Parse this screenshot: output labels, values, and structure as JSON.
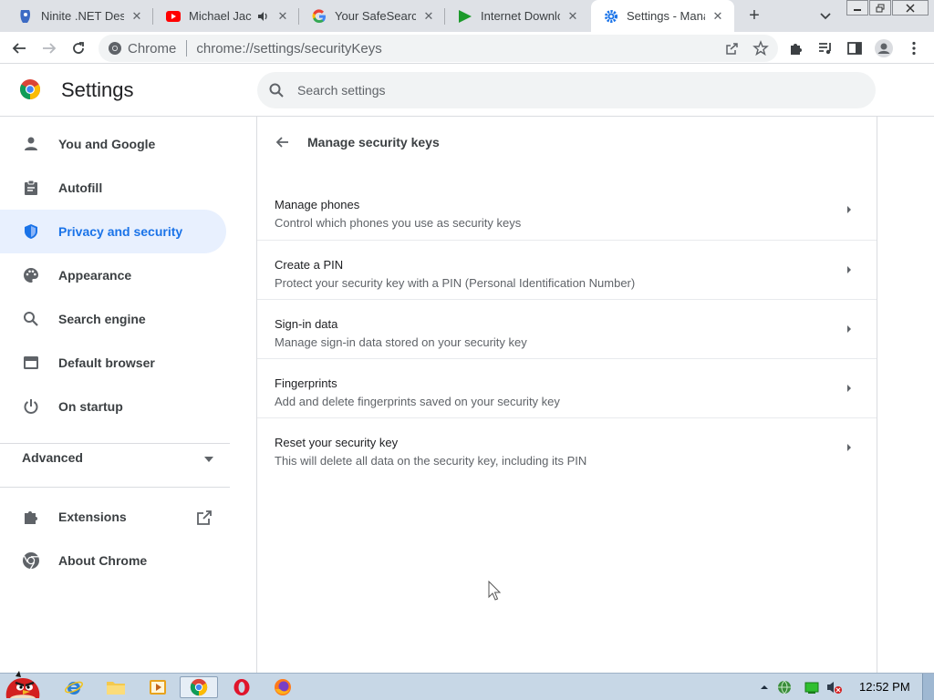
{
  "tabs": [
    {
      "title": "Ninite .NET Desk",
      "icon": "ninite-icon"
    },
    {
      "title": "Michael Jack",
      "icon": "youtube-icon",
      "audio": true
    },
    {
      "title": "Your SafeSearch",
      "icon": "google-icon"
    },
    {
      "title": "Internet Downlo",
      "icon": "idm-icon"
    },
    {
      "title": "Settings - Mana",
      "icon": "settings-gear-icon",
      "active": true
    }
  ],
  "omnibox": {
    "site": "Chrome",
    "url": "chrome://settings/securityKeys"
  },
  "settings": {
    "title": "Settings",
    "search_placeholder": "Search settings"
  },
  "sidebar": {
    "items": [
      {
        "label": "You and Google",
        "icon": "person-icon"
      },
      {
        "label": "Autofill",
        "icon": "clipboard-icon"
      },
      {
        "label": "Privacy and security",
        "icon": "shield-icon",
        "active": true
      },
      {
        "label": "Appearance",
        "icon": "palette-icon"
      },
      {
        "label": "Search engine",
        "icon": "search-icon"
      },
      {
        "label": "Default browser",
        "icon": "browser-window-icon"
      },
      {
        "label": "On startup",
        "icon": "power-icon"
      }
    ],
    "advanced": "Advanced",
    "extensions": "Extensions",
    "about": "About Chrome"
  },
  "page": {
    "title": "Manage security keys",
    "rows": [
      {
        "title": "Manage phones",
        "subtitle": "Control which phones you use as security keys"
      },
      {
        "title": "Create a PIN",
        "subtitle": "Protect your security key with a PIN (Personal Identification Number)"
      },
      {
        "title": "Sign-in data",
        "subtitle": "Manage sign-in data stored on your security key"
      },
      {
        "title": "Fingerprints",
        "subtitle": "Add and delete fingerprints saved on your security key"
      },
      {
        "title": "Reset your security key",
        "subtitle": "This will delete all data on the security key, including its PIN"
      }
    ]
  },
  "taskbar": {
    "clock": "12:52 PM"
  },
  "colors": {
    "accent": "#1a73e8",
    "active_nav_bg": "#e8f0fe",
    "tab_strip": "#dee1e6"
  }
}
